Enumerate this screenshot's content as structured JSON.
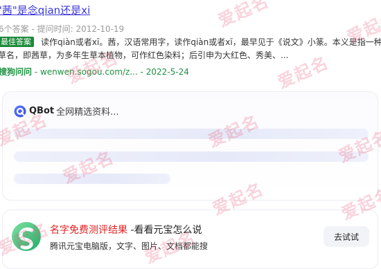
{
  "result": {
    "title": "\"茜\"是念qian还是xi",
    "meta": "6个答案 - 提问时间: 2012-10-19",
    "best_badge": "最佳答案",
    "body_text": "读作qiàn或者xī。茜，汉语常用字，读作qiàn或者xī，最早见于《说文》小篆。本义是指一种草名，即茜草，为多年生草本植物，可作红色染料；后引申为大红色、秀美、...",
    "source_name": "搜狗问问",
    "source_url": "- wenwen.sogou.com/z... - 2022-5-24"
  },
  "qbot": {
    "brand": "QBot",
    "status": "全网精选资料..."
  },
  "ad": {
    "title_highlight": "名字免费测评结果",
    "title_rest": " -看看元宝怎么说",
    "description": "腾讯元宝电脑版，文字、图片、文档都能搜",
    "try_button": "去试试"
  },
  "watermark_text": "爱起名",
  "colors": {
    "title_link": "#3b35d8",
    "source_green": "#1e9141",
    "badge_green": "#1c8a3a",
    "ad_red": "#e02020",
    "watermark": "#e75a78"
  }
}
